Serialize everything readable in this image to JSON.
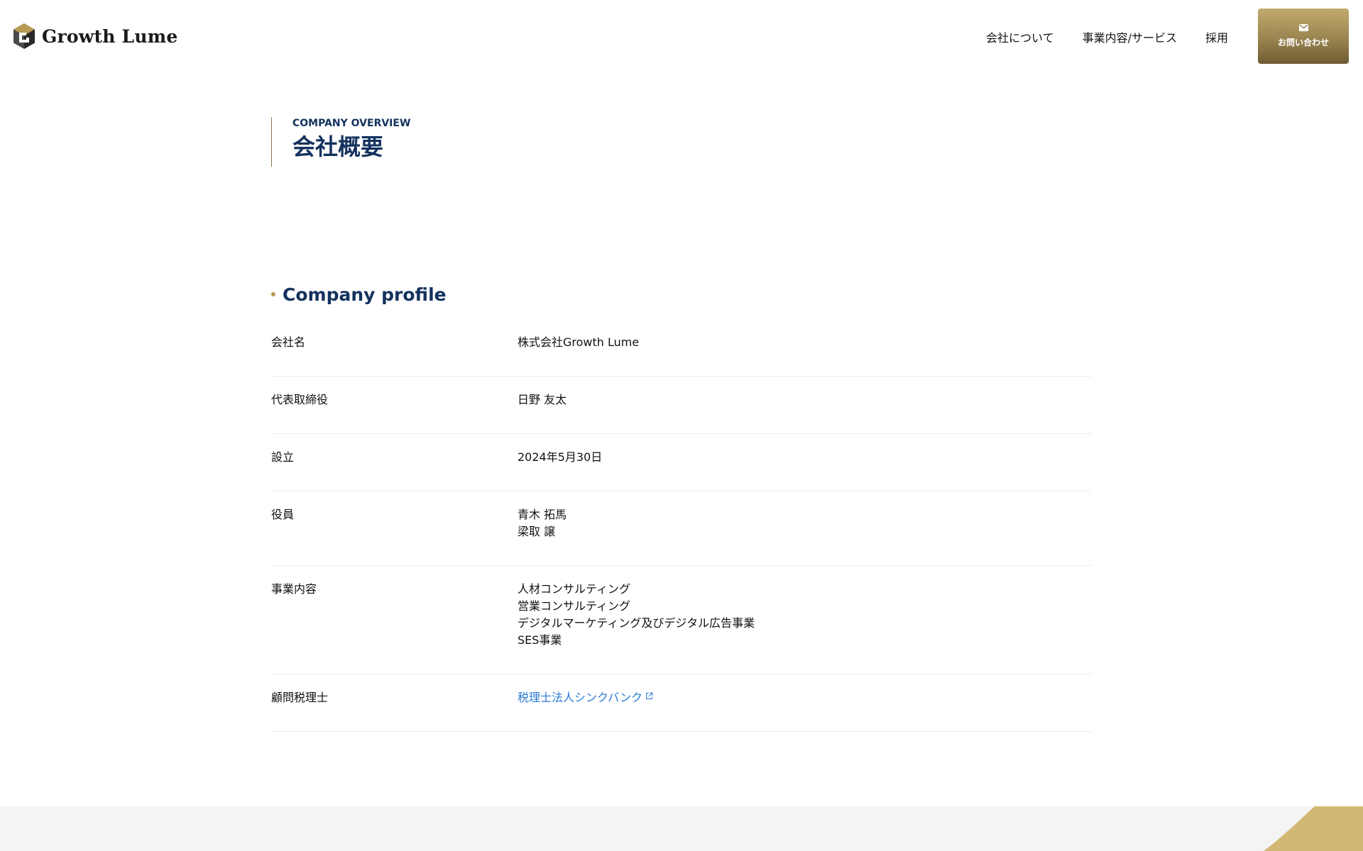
{
  "brand": {
    "name": "Growth Lume",
    "accent_color": "#b79a52",
    "heading_color": "#14325e",
    "link_color": "#2a7ad6"
  },
  "nav": {
    "items": [
      "会社について",
      "事業内容/サービス",
      "採用"
    ],
    "contact_label": "お問い合わせ",
    "contact_icon": "mail-icon"
  },
  "page": {
    "eyebrow": "COMPANY OVERVIEW",
    "title": "会社概要"
  },
  "profile": {
    "heading": "Company profile",
    "rows": [
      {
        "label": "会社名",
        "values": [
          "株式会社Growth Lume"
        ]
      },
      {
        "label": "代表取締役",
        "values": [
          "日野 友太"
        ]
      },
      {
        "label": "設立",
        "values": [
          "2024年5月30日"
        ]
      },
      {
        "label": "役員",
        "values": [
          "青木 拓馬",
          "梁取 譲"
        ]
      },
      {
        "label": "事業内容",
        "values": [
          "人材コンサルティング",
          "営業コンサルティング",
          "デジタルマーケティング及びデジタル広告事業",
          "SES事業"
        ]
      },
      {
        "label": "顧問税理士",
        "link": "税理士法人シンクバンク",
        "link_icon": "external-link-icon"
      }
    ]
  }
}
